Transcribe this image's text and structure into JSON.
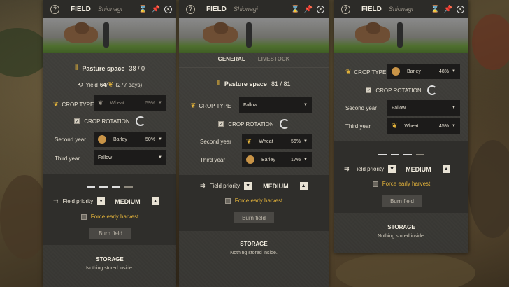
{
  "panels": [
    {
      "title": "FIELD",
      "subtitle": "Shionagi",
      "pasture": {
        "label": "Pasture space",
        "value": "38 / 0"
      },
      "yield": {
        "label": "Yield",
        "value": "64",
        "days": "(277 days)"
      },
      "crop_type": {
        "label": "CROP TYPE",
        "value": "Wheat",
        "pct": "59%"
      },
      "crop_rotation": {
        "label": "CROP ROTATION"
      },
      "second_year": {
        "label": "Second year",
        "value": "Barley",
        "pct": "50%"
      },
      "third_year": {
        "label": "Third year",
        "value": "Fallow"
      },
      "field_priority": {
        "label": "Field priority",
        "value": "MEDIUM"
      },
      "force_harvest": "Force early harvest",
      "burn_field": "Burn field",
      "storage": {
        "title": "STORAGE",
        "text": "Nothing stored inside."
      }
    },
    {
      "title": "FIELD",
      "subtitle": "Shionagi",
      "tabs": [
        "GENERAL",
        "LIVESTOCK"
      ],
      "pasture": {
        "label": "Pasture space",
        "value": "81 / 81"
      },
      "crop_type": {
        "label": "CROP TYPE",
        "value": "Fallow"
      },
      "crop_rotation": {
        "label": "CROP ROTATION"
      },
      "second_year": {
        "label": "Second year",
        "value": "Wheat",
        "pct": "56%"
      },
      "third_year": {
        "label": "Third year",
        "value": "Barley",
        "pct": "17%"
      },
      "field_priority": {
        "label": "Field priority",
        "value": "MEDIUM"
      },
      "force_harvest": "Force early harvest",
      "burn_field": "Burn field",
      "storage": {
        "title": "STORAGE",
        "text": "Nothing stored inside."
      }
    },
    {
      "title": "FIELD",
      "subtitle": "Shionagi",
      "crop_type": {
        "label": "CROP TYPE",
        "value": "Barley",
        "pct": "48%"
      },
      "crop_rotation": {
        "label": "CROP ROTATION"
      },
      "second_year": {
        "label": "Second year",
        "value": "Fallow"
      },
      "third_year": {
        "label": "Third year",
        "value": "Wheat",
        "pct": "45%"
      },
      "field_priority": {
        "label": "Field priority",
        "value": "MEDIUM"
      },
      "force_harvest": "Force early harvest",
      "burn_field": "Burn field",
      "storage": {
        "title": "STORAGE",
        "text": "Nothing stored inside."
      }
    }
  ],
  "colors": {
    "accent": "#e2b23a",
    "panel": "#3b3a36",
    "dropdown": "#1c1b1a"
  }
}
